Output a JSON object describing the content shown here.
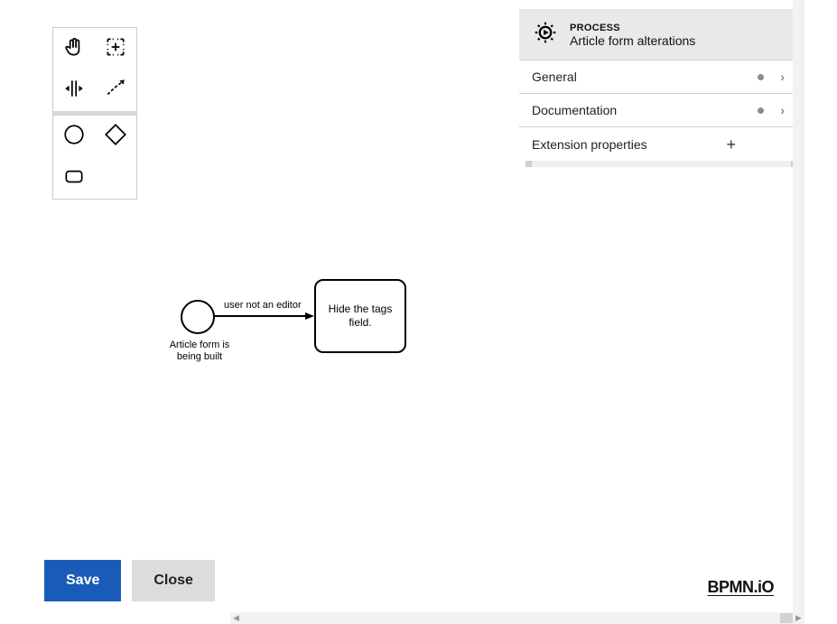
{
  "palette": {
    "tools": [
      "hand",
      "lasso",
      "space",
      "connection",
      "start-event",
      "gateway",
      "task"
    ]
  },
  "diagram": {
    "start_event_label": "Article form is being built",
    "sequence_flow_label": "user not an editor",
    "task_label": "Hide the tags field."
  },
  "properties": {
    "eyebrow": "PROCESS",
    "title": "Article form alterations",
    "sections": [
      {
        "label": "General",
        "has_data": true,
        "expandable": true
      },
      {
        "label": "Documentation",
        "has_data": true,
        "expandable": true
      },
      {
        "label": "Extension properties",
        "has_data": false,
        "expandable": false
      }
    ]
  },
  "footer": {
    "save_label": "Save",
    "close_label": "Close"
  },
  "brand": "BPMN.iO"
}
